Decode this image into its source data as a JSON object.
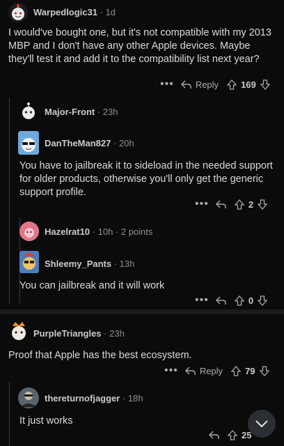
{
  "comments": [
    {
      "user": "Warpedlogic31",
      "meta": "· 1d",
      "body": "I would've bought one, but it's not compatible with my 2013 MBP and I don't have any other Apple devices. Maybe they'll test it and add it to the compatibility list next year?",
      "reply_label": "Reply",
      "score": "169"
    },
    {
      "user": "Major-Front",
      "meta": "· 23h"
    },
    {
      "user": "DanTheMan827",
      "meta": "· 20h",
      "body": "You have to jailbreak it to sideload in the needed support for older products, otherwise you'll only get the generic support profile.",
      "score": "2"
    },
    {
      "user": "Hazelrat10",
      "meta": "· 10h · 2 points"
    },
    {
      "user": "Shleemy_Pants",
      "meta": "· 13h",
      "body": "You can jailbreak and it will work",
      "score": "0"
    },
    {
      "user": "PurpleTriangles",
      "meta": "· 23h",
      "body": "Proof that Apple has the best ecosystem.",
      "reply_label": "Reply",
      "score": "79"
    },
    {
      "user": "thereturnofjagger",
      "meta": "· 18h",
      "body": "It just works",
      "score": "25"
    }
  ],
  "icons": [
    "more-icon",
    "reply-icon",
    "upvote-icon",
    "downvote-icon",
    "chevron-down-icon",
    "avatar"
  ],
  "colors": {
    "background": "#0b0b0b",
    "text": "#d7dadc",
    "muted": "#8b8f93",
    "divider": "#1a1a1b"
  }
}
